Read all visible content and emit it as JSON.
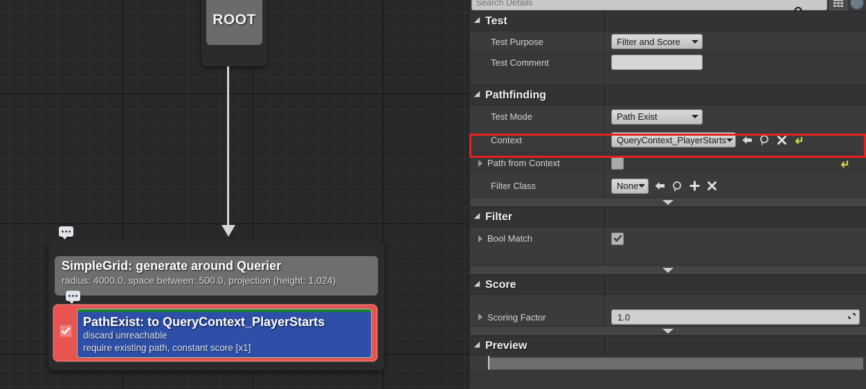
{
  "graph": {
    "root_node": {
      "label": "ROOT"
    },
    "generator_node": {
      "title": "SimpleGrid: generate around Querier",
      "subtitle": "radius: 4000.0, space between: 500.0, projection (height: 1,024)"
    },
    "test_node": {
      "title": "PathExist: to QueryContext_PlayerStarts",
      "line1": "discard unreachable",
      "line2": "require existing path, constant score [x1]",
      "enabled": true,
      "selected": true,
      "body_color": "#2d4fa8",
      "outline_color": "#e8544f",
      "accent_color": "#1d7d2f"
    },
    "comment_bubbles": [
      "comment-bubble-icon",
      "comment-bubble-icon"
    ]
  },
  "details": {
    "search": {
      "placeholder": "Search Details",
      "value": "",
      "magnifier_icon": "search-icon",
      "grid_view_icon": "grid-view-icon",
      "settings_icon": "settings-icon"
    },
    "sections": [
      {
        "name": "Test",
        "expanded": true,
        "rows": [
          {
            "label": "Test Purpose",
            "widget": "combo",
            "value": "Filter and Score"
          },
          {
            "label": "Test Comment",
            "widget": "textbox",
            "value": ""
          }
        ]
      },
      {
        "name": "Pathfinding",
        "expanded": true,
        "rows": [
          {
            "label": "Test Mode",
            "widget": "combo",
            "value": "Path Exist"
          },
          {
            "label": "Context",
            "widget": "combo",
            "value": "QueryContext_PlayerStarts",
            "icons": [
              "back-arrow-icon",
              "browse-icon",
              "clear-icon",
              "reset-icon"
            ],
            "highlighted": true
          },
          {
            "label": "Path from Context",
            "widget": "checkbox",
            "value": "unchecked",
            "expandable": true,
            "icons": [
              "reset-icon"
            ]
          },
          {
            "label": "Filter Class",
            "widget": "combo",
            "value": "None",
            "icons": [
              "back-arrow-icon",
              "browse-icon",
              "add-icon",
              "clear-icon"
            ]
          }
        ]
      },
      {
        "name": "Filter",
        "expanded": true,
        "rows": [
          {
            "label": "Bool Match",
            "widget": "checkbox",
            "value": "checked",
            "expandable": true
          }
        ]
      },
      {
        "name": "Score",
        "expanded": true,
        "rows": [
          {
            "label": "Scoring Factor",
            "widget": "number",
            "value": "1.0",
            "expandable": true
          }
        ]
      },
      {
        "name": "Preview",
        "expanded": true,
        "rows": []
      }
    ],
    "colors": {
      "highlight_box": "#e8211d",
      "panel_bg": "#383838",
      "row_bg": "#3b3b3b",
      "header_bg": "#333333",
      "reset_icon": "#cfd14a"
    }
  }
}
